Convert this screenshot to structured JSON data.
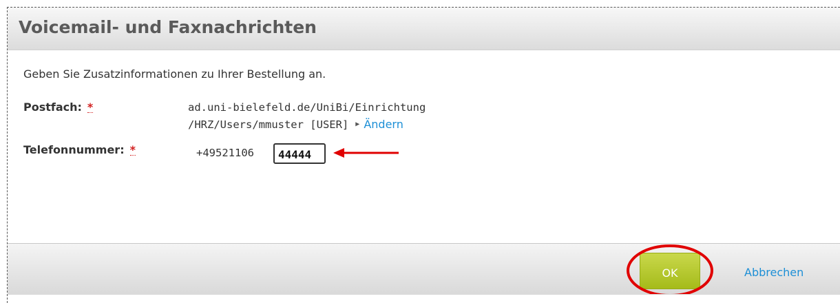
{
  "dialog": {
    "title": "Voicemail- und Faxnachrichten",
    "intro": "Geben Sie Zusatzinformationen zu Ihrer Bestellung an."
  },
  "form": {
    "required_marker": "*",
    "mailbox": {
      "label": "Postfach:",
      "path_line1": "ad.uni-bielefeld.de/UniBi/Einrichtung",
      "path_line2": "/HRZ/Users/mmuster [USER]",
      "change_label": "Ändern"
    },
    "phone": {
      "label": "Telefonnummer:",
      "prefix": "+49521106",
      "extension_value": "44444"
    }
  },
  "footer": {
    "ok_label": "OK",
    "cancel_label": "Abbrechen"
  },
  "colors": {
    "accent_green": "#b2c52a",
    "link_blue": "#1d8fd6",
    "required_red": "#d21f1f",
    "annotation_red": "#e00000"
  },
  "icons": {
    "change_marker": "triangle-right-icon",
    "annotation_arrow": "arrow-left-icon",
    "annotation_circle": "circle-highlight-icon"
  }
}
